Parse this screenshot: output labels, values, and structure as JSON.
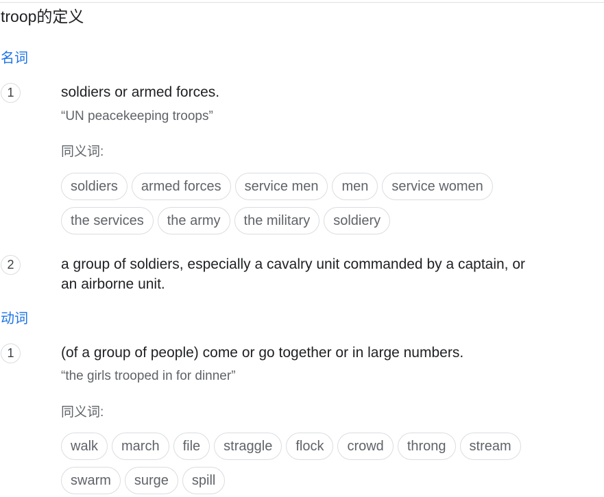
{
  "title": "troop的定义",
  "noun": {
    "label": "名词",
    "senses": [
      {
        "number": "1",
        "definition": "soldiers or armed forces.",
        "example": "“UN peacekeeping troops”",
        "synonyms_label": "同义词:",
        "synonyms": [
          "soldiers",
          "armed forces",
          "service men",
          "men",
          "service women",
          "the services",
          "the army",
          "the military",
          "soldiery"
        ]
      },
      {
        "number": "2",
        "definition": "a group of soldiers, especially a cavalry unit commanded by a captain, or an airborne unit."
      }
    ]
  },
  "verb": {
    "label": "动词",
    "senses": [
      {
        "number": "1",
        "definition": "(of a group of people) come or go together or in large numbers.",
        "example": "“the girls trooped in for dinner”",
        "synonyms_label": "同义词:",
        "synonyms": [
          "walk",
          "march",
          "file",
          "straggle",
          "flock",
          "crowd",
          "throng",
          "stream",
          "swarm",
          "surge",
          "spill"
        ]
      }
    ]
  }
}
